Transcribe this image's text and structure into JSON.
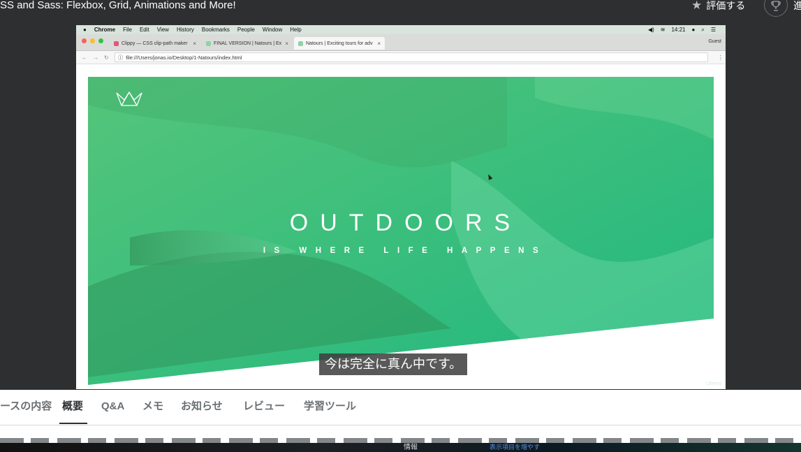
{
  "header": {
    "course_title": "SS and Sass: Flexbox, Grid, Animations and More!",
    "rate_label": "評価する",
    "cut_label": "進"
  },
  "mac_menu": {
    "apple": "",
    "app": "Chrome",
    "items": [
      "File",
      "Edit",
      "View",
      "History",
      "Bookmarks",
      "People",
      "Window",
      "Help"
    ],
    "clock": "14:21"
  },
  "browser": {
    "tabs": [
      {
        "title": "Clippy — CSS clip-path maker",
        "active": false
      },
      {
        "title": "FINAL VERSION | Natours | Ex",
        "active": false
      },
      {
        "title": "Natours | Exciting tours for adv",
        "active": true
      }
    ],
    "guest": "Guest",
    "url": "file:///Users/jonas.io/Desktop/1-Natours/index.html"
  },
  "hero": {
    "title": "OUTDOORS",
    "subtitle": "IS WHERE LIFE HAPPENS",
    "colors": {
      "top": "#55c57a",
      "bottom": "#28b485"
    }
  },
  "video": {
    "caption": "今は完全に真ん中です。",
    "watermark": "Udemy"
  },
  "course_tabs": {
    "items": [
      {
        "label": "ースの内容",
        "active": false
      },
      {
        "label": "概要",
        "active": true
      },
      {
        "label": "Q&A",
        "active": false
      },
      {
        "label": "メモ",
        "active": false
      },
      {
        "label": "お知らせ",
        "active": false
      },
      {
        "label": "レビュー",
        "active": false
      },
      {
        "label": "学習ツール",
        "active": false
      }
    ]
  },
  "taskbar": {
    "info": "情報",
    "link": "表示項目を増やす"
  }
}
